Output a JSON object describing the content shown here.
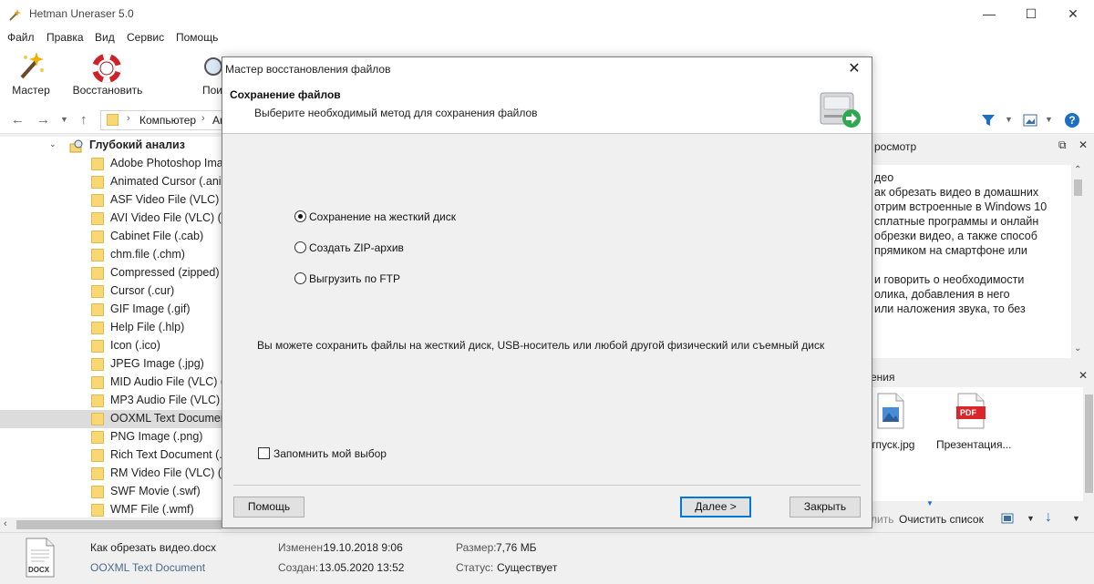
{
  "app": {
    "title": "Hetman Uneraser 5.0"
  },
  "window_controls": {
    "minimize": "—",
    "maximize": "☐",
    "close": "✕"
  },
  "menu": [
    "Файл",
    "Правка",
    "Вид",
    "Сервис",
    "Помощь"
  ],
  "toolbar": {
    "wizard": "Мастер",
    "restore": "Восстановить",
    "search_partial": "Пои"
  },
  "address": {
    "computer": "Компьютер",
    "next_partial": "Ar"
  },
  "tree": {
    "root": "Глубокий анализ",
    "items": [
      "Adobe Photoshop Imag",
      "Animated Cursor (.ani)",
      "ASF Video File (VLC) (.a",
      "AVI Video File (VLC) (.a",
      "Cabinet File (.cab)",
      "chm.file (.chm)",
      "Compressed (zipped) F",
      "Cursor (.cur)",
      "GIF Image (.gif)",
      "Help File (.hlp)",
      "Icon (.ico)",
      "JPEG Image (.jpg)",
      "MID Audio File (VLC) (.",
      "MP3 Audio File (VLC) (.",
      "OOXML Text Documen",
      "PNG Image (.png)",
      "Rich Text Document (.r",
      "RM Video File (VLC) (.r",
      "SWF Movie (.swf)",
      "WMF File (.wmf)"
    ],
    "selected_index": 14
  },
  "preview": {
    "header_partial": "росмотр",
    "lines": [
      "део",
      "ак обрезать видео в домашних",
      "отрим встроенные в Windows 10",
      "сплатные программы и онлайн",
      "обрезки видео, а также способ",
      "прямиком на смартфоне или",
      "",
      "и говорить о необходимости",
      "олика, добавления в него",
      "или наложения звука, то без"
    ]
  },
  "recovery": {
    "header_partial": "ения",
    "files": [
      "тпуск.jpg",
      "Презентация..."
    ],
    "pdf_label": "PDF",
    "clear_partial": "лить",
    "clear_list": "Очистить список"
  },
  "details": {
    "filename": "Как обрезать видео.docx",
    "filetype": "OOXML Text Document",
    "modified_label": "Изменен:",
    "modified_value": "19.10.2018 9:06",
    "created_label": "Создан:",
    "created_value": "13.05.2020 13:52",
    "size_label": "Размер:",
    "size_value": "7,76 МБ",
    "status_label": "Статус:",
    "status_value": "Существует",
    "icon_label": "DOCX"
  },
  "dialog": {
    "title": "Мастер восстановления файлов",
    "close": "✕",
    "header_title": "Сохранение файлов",
    "header_subtitle": "Выберите необходимый метод для сохранения файлов",
    "options": [
      "Сохранение на жесткий диск",
      "Создать ZIP-архив",
      "Выгрузить по FTP"
    ],
    "selected_option": 0,
    "description": "Вы можете сохранить файлы на жесткий диск, USB-носитель или любой другой физический или съемный диск",
    "remember": "Запомнить мой выбор",
    "help_button": "Помощь",
    "next_button": "Далее >",
    "close_button": "Закрыть"
  },
  "colors": {
    "accent": "#0078d7",
    "folder": "#f8d775",
    "pdf_red": "#d9262b",
    "selected_row": "#dcdcdc"
  }
}
